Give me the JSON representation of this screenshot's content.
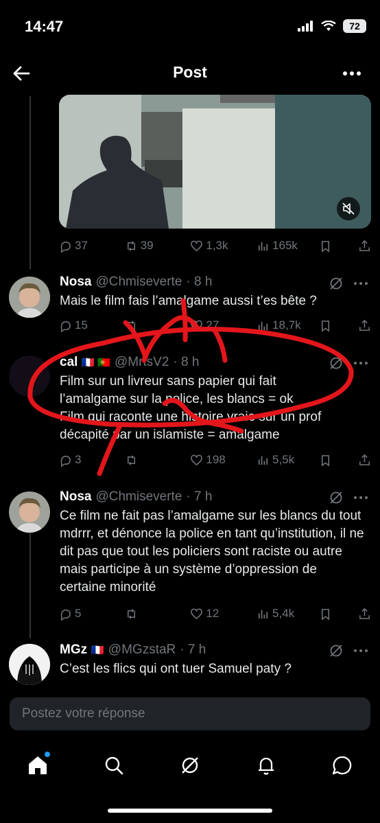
{
  "status_bar": {
    "time": "14:47",
    "battery": "72"
  },
  "header": {
    "title": "Post"
  },
  "main_post": {
    "actions": {
      "replies": "37",
      "reposts": "39",
      "likes": "1,3k",
      "views": "165k"
    }
  },
  "replies": [
    {
      "name": "Nosa",
      "handle": "@Chmiseverte",
      "time": "· 8 h",
      "text": "Mais le film fais l’amalgame aussi t’es bête ?",
      "actions": {
        "replies": "15",
        "reposts": "",
        "likes": "27",
        "views": "18,7k"
      }
    },
    {
      "name": "cal",
      "flags": "🇫🇷 🇵🇹",
      "handle": "@MrtsV2",
      "time": "· 8 h",
      "text_lines": [
        "Film sur un livreur sans papier qui fait",
        "l’amalgame sur la police, les blancs = ok",
        "Film qui raconte une histoire vraie sur un prof",
        "décapité par un islamiste = amalgame"
      ],
      "actions": {
        "replies": "3",
        "reposts": "",
        "likes": "198",
        "views": "5,5k"
      }
    },
    {
      "name": "Nosa",
      "handle": "@Chmiseverte",
      "time": "· 7 h",
      "text": "Ce film ne fait pas l’amalgame sur les blancs du tout mdrrr, et dénonce la police en tant qu’institution, il ne dit pas que tout les policiers sont raciste ou autre mais participe à un système d’oppression de certaine minorité",
      "actions": {
        "replies": "5",
        "reposts": "",
        "likes": "12",
        "views": "5,4k"
      }
    },
    {
      "name": "MGz",
      "flags": "🇫🇷",
      "handle": "@MGzstaR",
      "time": "· 7 h",
      "text": "C’est les flics qui ont tuer Samuel paty ?"
    }
  ],
  "reply_bar": {
    "placeholder": "Postez votre réponse"
  },
  "colors": {
    "annotation": "#e3161b",
    "accent": "#1d9bf0",
    "muted": "#71767b"
  },
  "nav": [
    "home-icon",
    "search-icon",
    "grok-icon",
    "bell-icon",
    "messages-icon"
  ]
}
